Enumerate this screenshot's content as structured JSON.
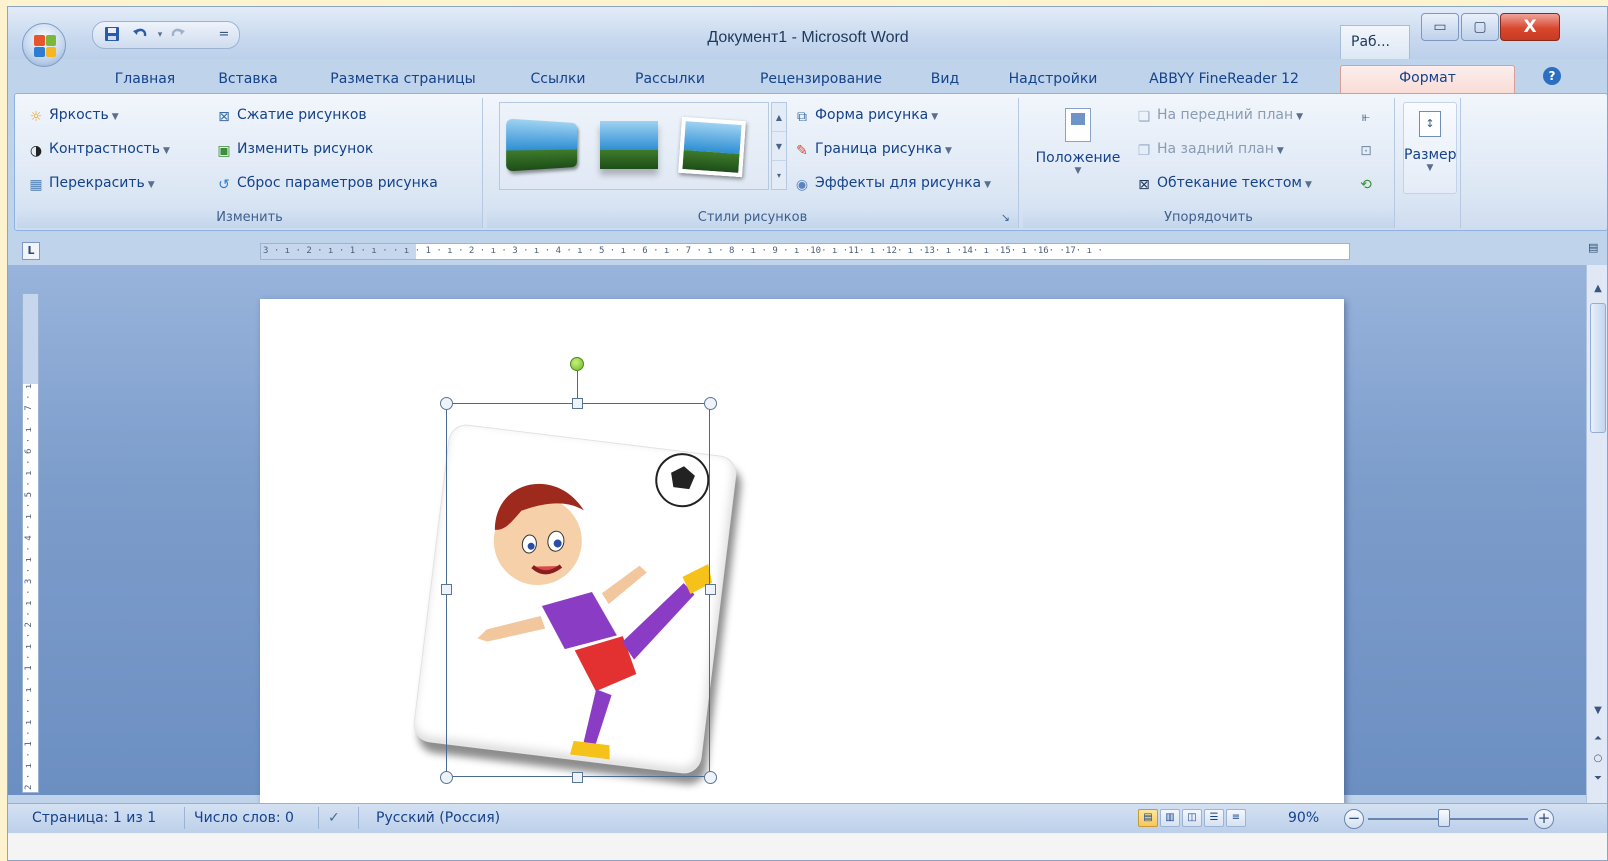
{
  "window": {
    "title": "Документ1 - Microsoft Word",
    "context_tab_label": "Раб...",
    "minimize_glyph": "▭",
    "maximize_glyph": "▢",
    "close_glyph": "X"
  },
  "quick_access": {
    "save_icon": "save-icon",
    "undo_icon": "undo-icon",
    "redo_icon": "redo-icon",
    "customize_glyph": "="
  },
  "tabs": [
    {
      "label": "Главная"
    },
    {
      "label": "Вставка"
    },
    {
      "label": "Разметка страницы"
    },
    {
      "label": "Ссылки"
    },
    {
      "label": "Рассылки"
    },
    {
      "label": "Рецензирование"
    },
    {
      "label": "Вид"
    },
    {
      "label": "Надстройки"
    },
    {
      "label": "ABBYY FineReader 12"
    },
    {
      "label": "Формат",
      "active": true
    }
  ],
  "help_glyph": "?",
  "ribbon": {
    "adjust": {
      "label": "Изменить",
      "brightness": "Яркость",
      "contrast": "Контрастность",
      "recolor": "Перекрасить",
      "compress": "Сжатие рисунков",
      "change_picture": "Изменить рисунок",
      "reset_picture": "Сброс параметров рисунка"
    },
    "styles": {
      "label": "Стили рисунков",
      "shape": "Форма рисунка",
      "border": "Граница рисунка",
      "effects": "Эффекты для рисунка",
      "dialog_launcher": "↘"
    },
    "arrange": {
      "label": "Упорядочить",
      "position": "Положение",
      "bring_front": "На передний план",
      "send_back": "На задний план",
      "text_wrap": "Обтекание текстом"
    },
    "size": {
      "label": "Размер"
    }
  },
  "ruler": {
    "corner_glyph": "L",
    "ticks": "3 · ı · 2 · ı · 1 · ı ·    · ı · 1 · ı · 2 · ı · 3 · ı · 4 · ı · 5 · ı · 6 · ı · 7 · ı · 8 · ı · 9 · ı ·10· ı ·11· ı ·12· ı ·13· ı ·14· ı ·15· ı ·16·  ·17· ı ·",
    "vertical_ticks": "2 · ı · 1 · ı ·      · ı · 1 · ı · 2 · ı · 3 · ı · 4 · ı · 5 · ı · 6 · ı · 7 · ı"
  },
  "statusbar": {
    "page": "Страница: 1 из 1",
    "words": "Число слов: 0",
    "language": "Русский (Россия)",
    "zoom": "90%",
    "zoom_out": "−",
    "zoom_in": "+"
  },
  "colors": {
    "accent": "#15428b",
    "active_tab": "#f9dcd6",
    "close_button": "#d9472f"
  }
}
